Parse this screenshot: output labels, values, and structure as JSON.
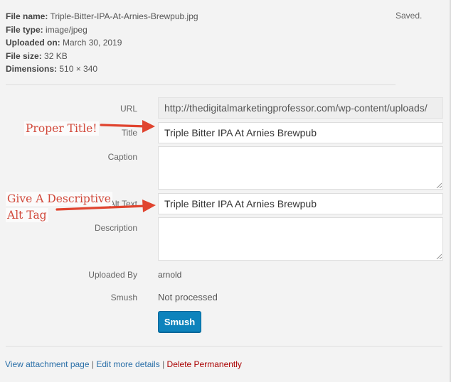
{
  "file_info": {
    "file_name_label": "File name:",
    "file_name": "Triple-Bitter-IPA-At-Arnies-Brewpub.jpg",
    "file_type_label": "File type:",
    "file_type": "image/jpeg",
    "uploaded_on_label": "Uploaded on:",
    "uploaded_on": "March 30, 2019",
    "file_size_label": "File size:",
    "file_size": "32 KB",
    "dimensions_label": "Dimensions:",
    "dimensions": "510 × 340"
  },
  "status": {
    "saved": "Saved."
  },
  "form": {
    "url_label": "URL",
    "url_value": "http://thedigitalmarketingprofessor.com/wp-content/uploads/",
    "title_label": "Title",
    "title_value": "Triple Bitter IPA At Arnies Brewpub",
    "caption_label": "Caption",
    "caption_value": "",
    "alt_label": "Alt Text",
    "alt_value": "Triple Bitter IPA At Arnies Brewpub",
    "description_label": "Description",
    "description_value": "",
    "uploaded_by_label": "Uploaded By",
    "uploaded_by_value": "arnold",
    "smush_label": "Smush",
    "smush_value": "Not processed",
    "smush_button": "Smush"
  },
  "links": {
    "view_attachment": "View attachment page",
    "separator": "|",
    "edit_details": "Edit more details",
    "delete": "Delete Permanently"
  },
  "annotations": {
    "proper_title": "Proper Title!",
    "alt_line1": "Give A Descriptive",
    "alt_line2": "Alt Tag"
  },
  "colors": {
    "annotation": "#d1483a",
    "button": "#0e83bc",
    "link": "#2a6fa8",
    "delete_link": "#aa0000"
  }
}
